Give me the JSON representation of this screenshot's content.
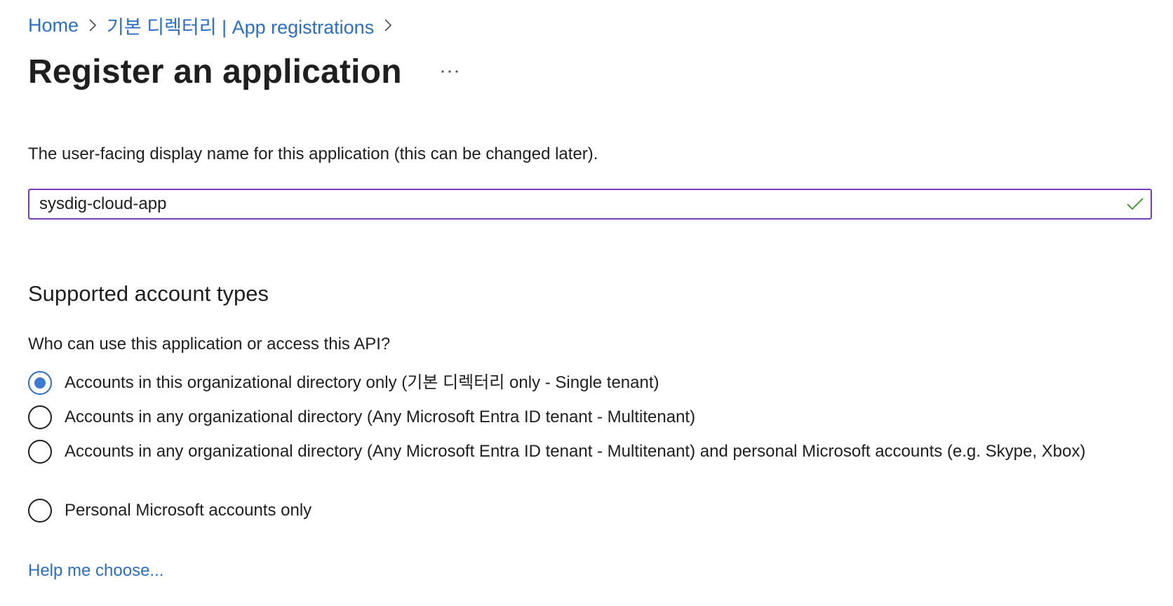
{
  "breadcrumb": {
    "home": "Home",
    "app_registrations": "기본 디렉터리 | App registrations"
  },
  "page": {
    "title": "Register an application",
    "more_label": "···"
  },
  "name_section": {
    "description": "The user-facing display name for this application (this can be changed later).",
    "value": "sysdig-cloud-app",
    "valid": true
  },
  "account_types": {
    "heading": "Supported account types",
    "question": "Who can use this application or access this API?",
    "options": [
      {
        "label": "Accounts in this organizational directory only (기본 디렉터리 only - Single tenant)",
        "selected": true
      },
      {
        "label": "Accounts in any organizational directory (Any Microsoft Entra ID tenant - Multitenant)",
        "selected": false
      },
      {
        "label": "Accounts in any organizational directory (Any Microsoft Entra ID tenant - Multitenant) and personal Microsoft accounts (e.g. Skype, Xbox)",
        "selected": false
      },
      {
        "label": "Personal Microsoft accounts only",
        "selected": false
      }
    ],
    "help_link": "Help me choose..."
  },
  "colors": {
    "link": "#2b6fc7",
    "input_border": "#7a3db8",
    "valid_check": "#4f9a3f",
    "radio_selected": "#3b7bd4"
  }
}
